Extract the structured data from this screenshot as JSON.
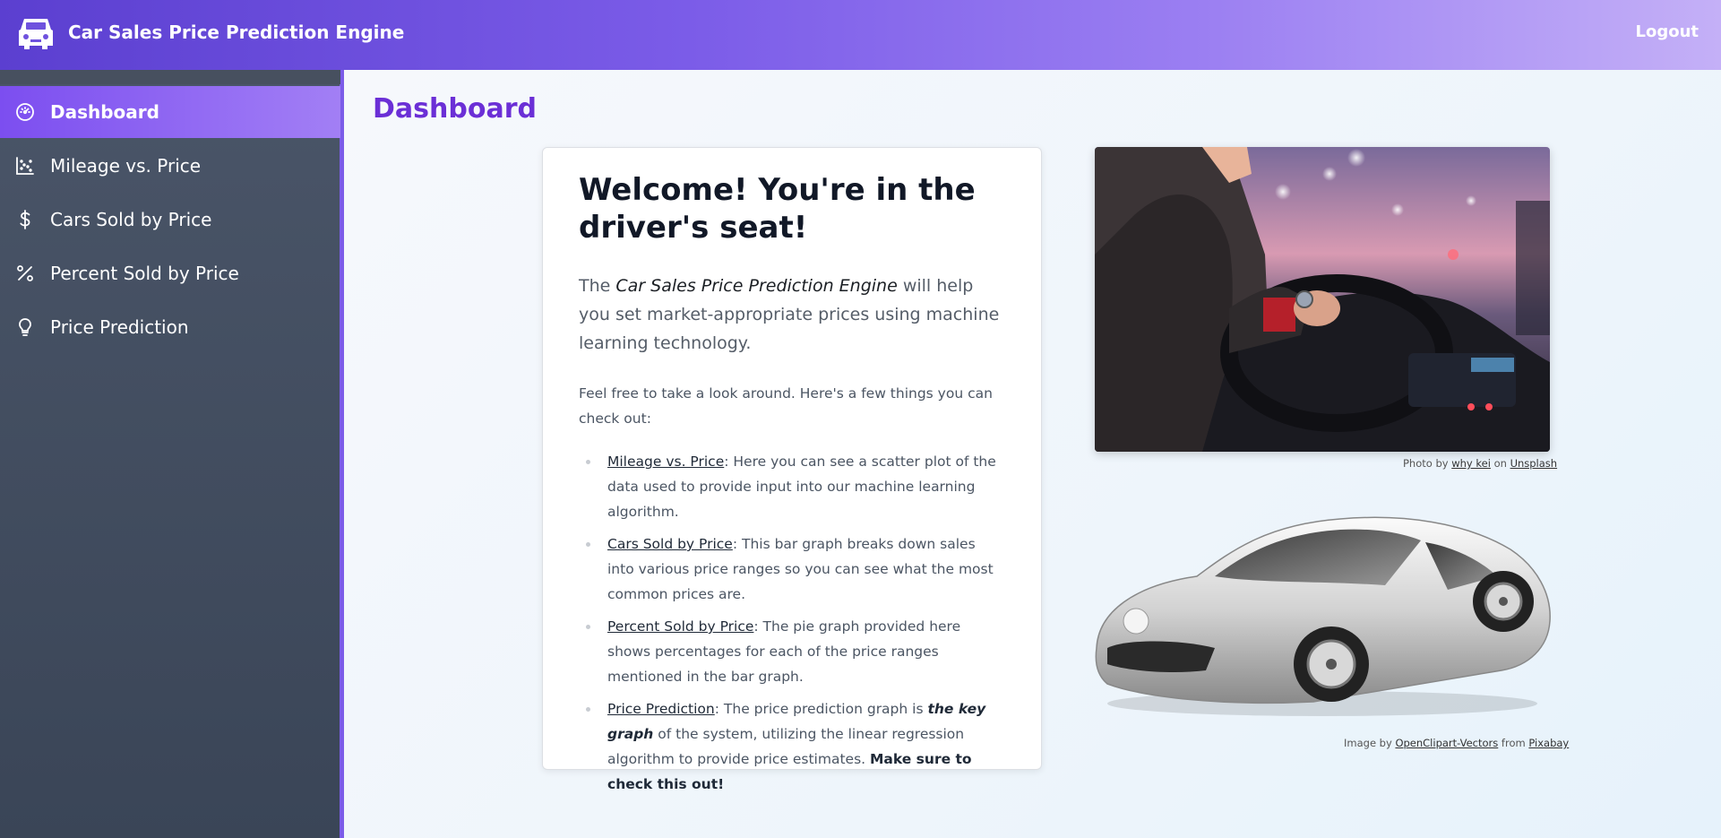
{
  "header": {
    "logo_icon": "car-icon",
    "title": "Car Sales Price Prediction Engine",
    "logout_label": "Logout"
  },
  "sidebar": {
    "items": [
      {
        "label": "Dashboard",
        "icon": "speedometer-icon",
        "active": true
      },
      {
        "label": "Mileage vs. Price",
        "icon": "scatter-chart-icon",
        "active": false
      },
      {
        "label": "Cars Sold by Price",
        "icon": "dollar-icon",
        "active": false
      },
      {
        "label": "Percent Sold by Price",
        "icon": "percent-icon",
        "active": false
      },
      {
        "label": "Price Prediction",
        "icon": "lightbulb-icon",
        "active": false
      }
    ]
  },
  "main": {
    "page_title": "Dashboard",
    "welcome": {
      "heading": "Welcome! You're in the driver's seat!",
      "lead_prefix": "The ",
      "lead_em": "Car Sales Price Prediction Engine",
      "lead_suffix": " will help you set market-appropriate prices using machine learning technology.",
      "intro": "Feel free to take a look around. Here's a few things you can check out:",
      "list": [
        {
          "link": "Mileage vs. Price",
          "text": ": Here you can see a scatter plot of the data used to provide input into our machine learning algorithm."
        },
        {
          "link": "Cars Sold by Price",
          "text": ": This bar graph breaks down sales into various price ranges so you can see what the most common prices are."
        },
        {
          "link": "Percent Sold by Price",
          "text": ": The pie graph provided here shows percentages for each of the price ranges mentioned in the bar graph."
        },
        {
          "link": "Price Prediction",
          "text_a": ": The price prediction graph is ",
          "emph": "the key graph",
          "text_b": " of the system, utilizing the linear regression algorithm to provide price estimates. ",
          "strong": "Make sure to check this out!"
        }
      ]
    },
    "photo_caption": {
      "prefix": "Photo by ",
      "author": "why kei",
      "mid": " on ",
      "source": "Unsplash"
    },
    "car_caption": {
      "prefix": "Image by ",
      "author": "OpenClipart-Vectors",
      "mid": " from ",
      "source": "Pixabay"
    }
  },
  "colors": {
    "accent": "#7c4ef0",
    "title": "#6b2fd6",
    "sidebar_bg": "#3f4a5c"
  }
}
